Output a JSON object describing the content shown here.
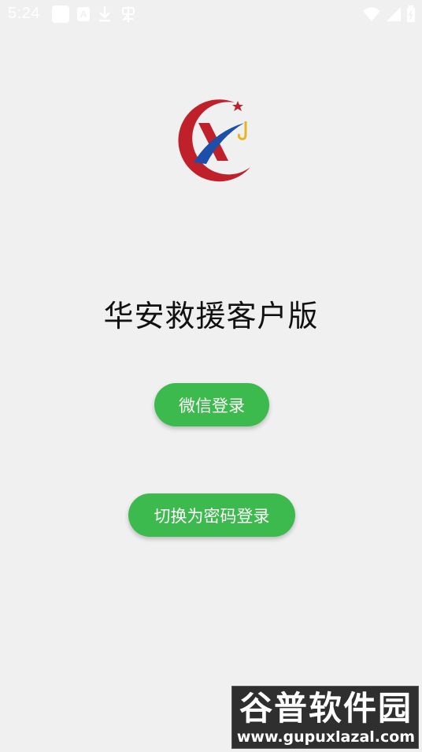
{
  "status_bar": {
    "time": "5:24",
    "notification_icons": [
      "app-square-icon",
      "text-a-icon",
      "download-icon",
      "bug-icon"
    ],
    "system_icons": [
      "wifi-icon",
      "signal-icon",
      "battery-icon"
    ]
  },
  "app": {
    "logo_icon": "huaan-rescue-logo",
    "title": "华安救援客户版"
  },
  "buttons": {
    "wechat_login": "微信登录",
    "password_login": "切换为密码登录"
  },
  "watermark": {
    "title": "谷普软件园",
    "url": "www.gupuxlazal.com"
  },
  "colors": {
    "background": "#f0f0f0",
    "button_green": "#3dba4e",
    "logo_red": "#c0202a",
    "logo_blue": "#1e4fa8",
    "logo_gold": "#e8b422"
  }
}
